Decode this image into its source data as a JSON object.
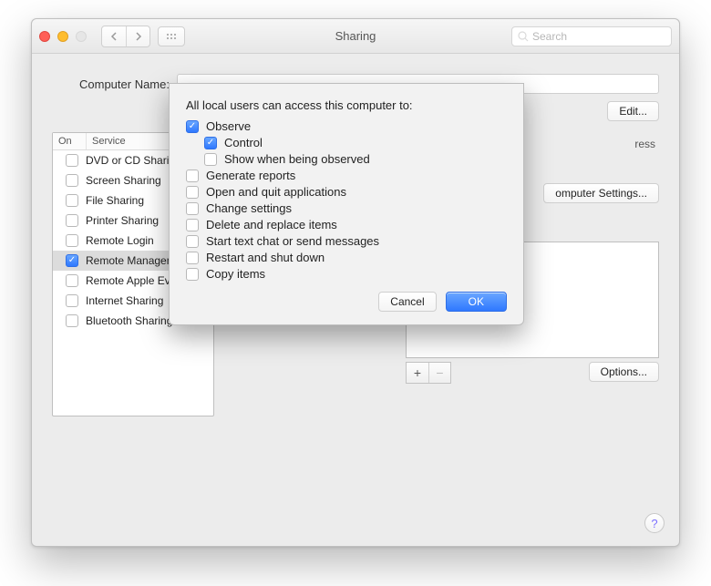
{
  "window": {
    "title": "Sharing"
  },
  "search": {
    "placeholder": "Search"
  },
  "computer_name": {
    "label": "Computer Name:",
    "value": "",
    "edit": "Edit..."
  },
  "services": {
    "col_on": "On",
    "col_service": "Service",
    "items": [
      {
        "label": "DVD or CD Sharing",
        "checked": false,
        "selected": false
      },
      {
        "label": "Screen Sharing",
        "checked": false,
        "selected": false
      },
      {
        "label": "File Sharing",
        "checked": false,
        "selected": false
      },
      {
        "label": "Printer Sharing",
        "checked": false,
        "selected": false
      },
      {
        "label": "Remote Login",
        "checked": false,
        "selected": false
      },
      {
        "label": "Remote Management",
        "checked": true,
        "selected": true
      },
      {
        "label": "Remote Apple Events",
        "checked": false,
        "selected": false
      },
      {
        "label": "Internet Sharing",
        "checked": false,
        "selected": false
      },
      {
        "label": "Bluetooth Sharing",
        "checked": false,
        "selected": false
      }
    ]
  },
  "detail": {
    "address_fragment": "ress",
    "computer_settings": "omputer Settings...",
    "options": "Options...",
    "plus": "+",
    "minus": "−"
  },
  "dialog": {
    "heading": "All local users can access this computer to:",
    "options": [
      {
        "label": "Observe",
        "checked": true,
        "indent": 0
      },
      {
        "label": "Control",
        "checked": true,
        "indent": 1
      },
      {
        "label": "Show when being observed",
        "checked": false,
        "indent": 1
      },
      {
        "label": "Generate reports",
        "checked": false,
        "indent": 0
      },
      {
        "label": "Open and quit applications",
        "checked": false,
        "indent": 0
      },
      {
        "label": "Change settings",
        "checked": false,
        "indent": 0
      },
      {
        "label": "Delete and replace items",
        "checked": false,
        "indent": 0
      },
      {
        "label": "Start text chat or send messages",
        "checked": false,
        "indent": 0
      },
      {
        "label": "Restart and shut down",
        "checked": false,
        "indent": 0
      },
      {
        "label": "Copy items",
        "checked": false,
        "indent": 0
      }
    ],
    "cancel": "Cancel",
    "ok": "OK"
  },
  "help": "?"
}
